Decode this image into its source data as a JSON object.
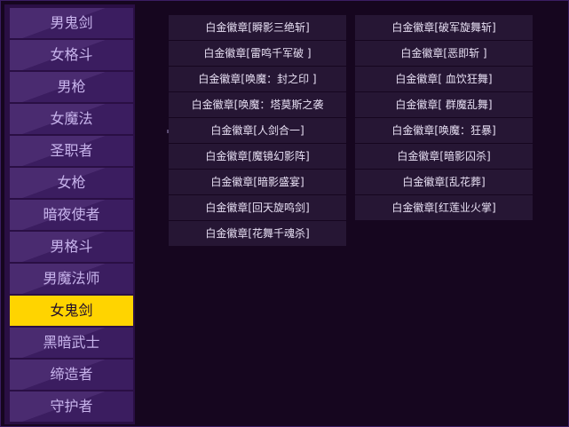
{
  "sidebar": {
    "items": [
      {
        "label": "男鬼剑"
      },
      {
        "label": "女格斗"
      },
      {
        "label": "男枪"
      },
      {
        "label": "女魔法"
      },
      {
        "label": "圣职者"
      },
      {
        "label": "女枪"
      },
      {
        "label": "暗夜使者"
      },
      {
        "label": "男格斗"
      },
      {
        "label": "男魔法师"
      },
      {
        "label": "女鬼剑"
      },
      {
        "label": "黑暗武士"
      },
      {
        "label": "缔造者"
      },
      {
        "label": "守护者"
      }
    ],
    "active_index": 9
  },
  "badges": {
    "left": [
      "白金徽章[瞬影三绝斩]",
      "白金徽章[雷鸣千军破 ]",
      "白金徽章[唤魔：封之印 ]",
      "白金徽章[唤魔：塔莫斯之袭",
      "白金徽章[人剑合一]",
      "白金徽章[魔镜幻影阵]",
      "白金徽章[暗影盛宴]",
      "白金徽章[回天旋鸣剑]",
      "白金徽章[花舞千魂杀]"
    ],
    "right": [
      "白金徽章[破军旋舞斩]",
      "白金徽章[恶即斩 ]",
      "白金徽章[ 血饮狂舞]",
      "白金徽章[ 群魔乱舞]",
      "白金徽章[唤魔：狂暴]",
      "白金徽章[暗影囚杀]",
      "白金徽章[乱花葬]",
      "白金徽章[红莲业火掌]"
    ]
  },
  "colors": {
    "background": "#170522",
    "sidebar_item": "#4a2b70",
    "sidebar_active": "#ffd400",
    "cell": "#261634"
  }
}
